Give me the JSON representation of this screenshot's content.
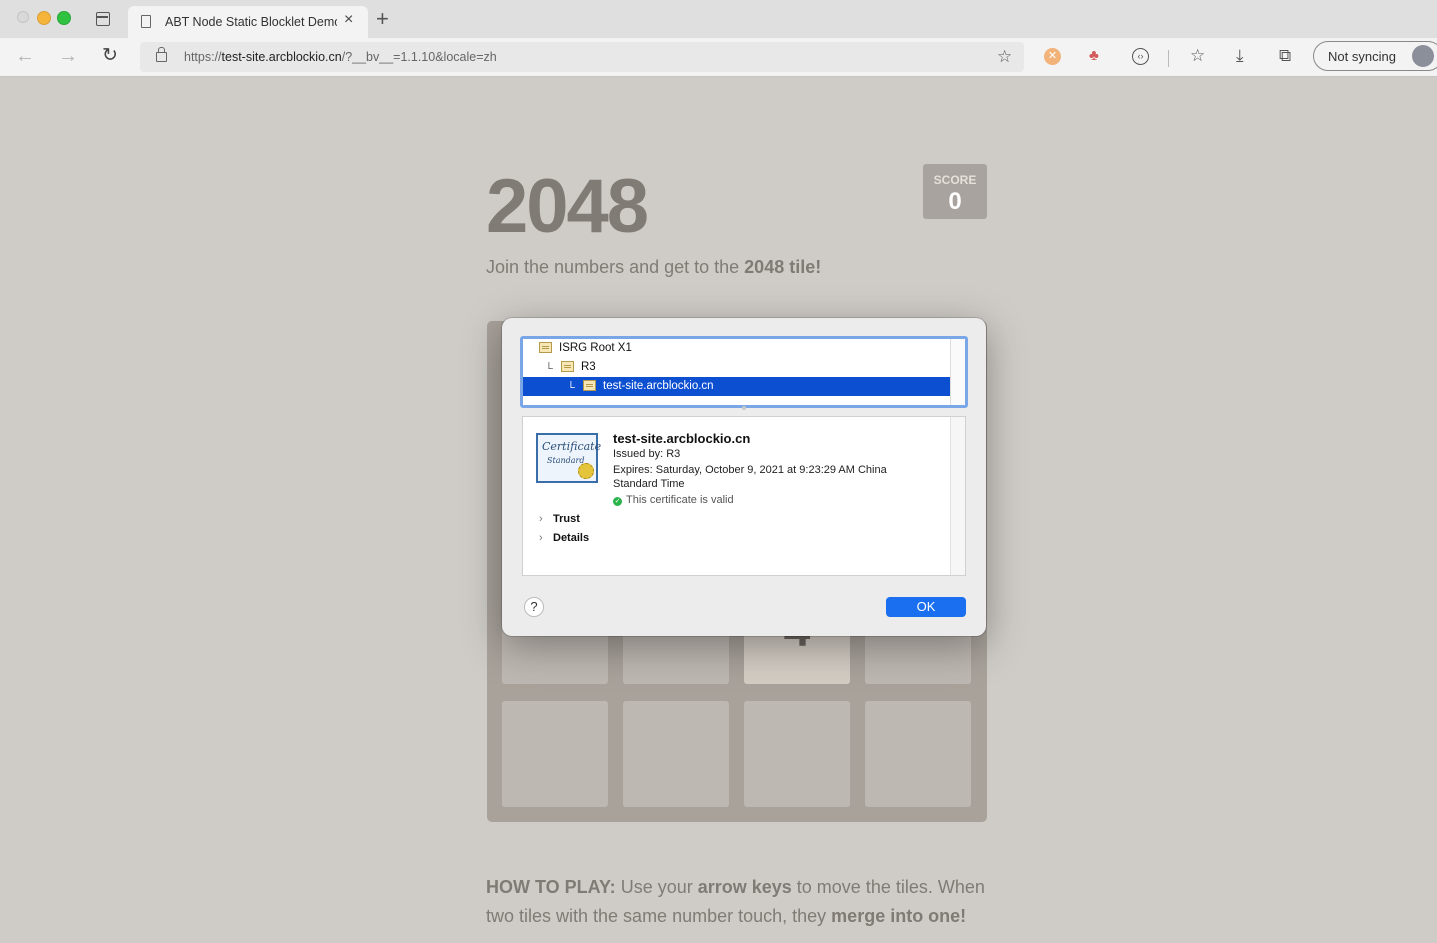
{
  "browser": {
    "tab": {
      "title": "ABT Node Static Blocklet Demo"
    },
    "url": {
      "scheme": "https://",
      "host": "test-site.arcblockio.cn",
      "path": "/?__bv__=1.1.10&locale=zh"
    },
    "profile": {
      "label": "Not syncing"
    }
  },
  "game": {
    "title": "2048",
    "score_label": "SCORE",
    "score_value": "0",
    "intro_prefix": "Join the numbers and get to the ",
    "intro_bold": "2048 tile!",
    "visible_tile": "4",
    "howto": {
      "label": "HOW TO PLAY:",
      "t1": " Use your ",
      "b1": "arrow keys",
      "t2": " to move the tiles. When two tiles with the same number touch, they ",
      "b2": "merge into one!"
    }
  },
  "cert_dialog": {
    "chain": [
      "ISRG Root X1",
      "R3",
      "test-site.arcblockio.cn"
    ],
    "cert_image_text": [
      "Certificate",
      "Standard"
    ],
    "name": "test-site.arcblockio.cn",
    "issued_by": "Issued by: R3",
    "expires_line1": "Expires: Saturday, October 9, 2021 at 9:23:29 AM China",
    "expires_line2": "Standard Time",
    "valid": "This certificate is valid",
    "sections": [
      "Trust",
      "Details"
    ],
    "help": "?",
    "ok": "OK"
  },
  "colors": {
    "accent": "#1a6ff0",
    "selection": "#0d4fd1",
    "valid": "#29b34a"
  }
}
